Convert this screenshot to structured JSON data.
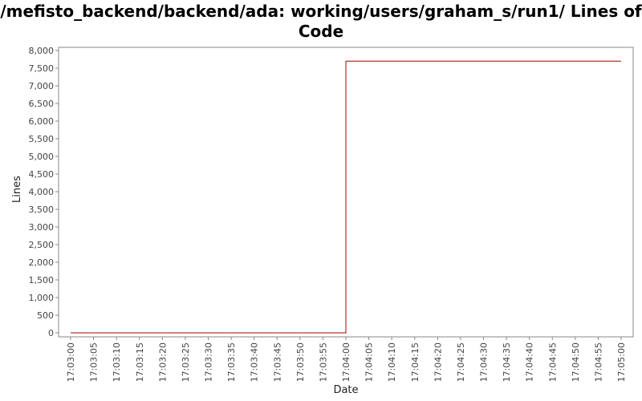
{
  "chart_data": {
    "type": "line",
    "title": "/mefisto_backend/backend/ada: working/users/graham_s/run1/ Lines of Code",
    "xlabel": "Date",
    "ylabel": "Lines",
    "ylim": [
      0,
      8000
    ],
    "yticks": [
      0,
      500,
      1000,
      1500,
      2000,
      2500,
      3000,
      3500,
      4000,
      4500,
      5000,
      5500,
      6000,
      6500,
      7000,
      7500,
      8000
    ],
    "ytick_labels": [
      "0",
      "500",
      "1,000",
      "1,500",
      "2,000",
      "2,500",
      "3,000",
      "3,500",
      "4,000",
      "4,500",
      "5,000",
      "5,500",
      "6,000",
      "6,500",
      "7,000",
      "7,500",
      "8,000"
    ],
    "xtick_labels": [
      "17:03:00",
      "17:03:05",
      "17:03:10",
      "17:03:15",
      "17:03:20",
      "17:03:25",
      "17:03:30",
      "17:03:35",
      "17:03:40",
      "17:03:45",
      "17:03:50",
      "17:03:55",
      "17:04:00",
      "17:04:05",
      "17:04:10",
      "17:04:15",
      "17:04:20",
      "17:04:25",
      "17:04:30",
      "17:04:35",
      "17:04:40",
      "17:04:45",
      "17:04:50",
      "17:04:55",
      "17:05:00"
    ],
    "grid": false,
    "series": [
      {
        "step": true,
        "color": "#aa0000",
        "x": [
          "17:03:00",
          "17:04:00",
          "17:05:00"
        ],
        "y": [
          0,
          7700,
          7700
        ]
      }
    ]
  }
}
